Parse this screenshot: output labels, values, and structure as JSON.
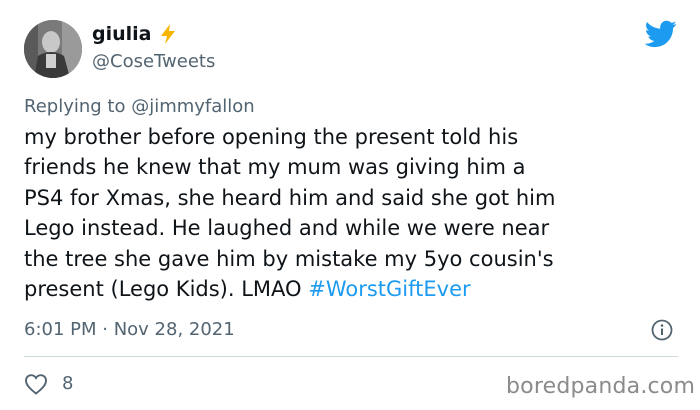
{
  "author": {
    "display_name": "giulia",
    "handle": "@CoseTweets",
    "verified_emoji": "lightning-icon"
  },
  "reply": {
    "prefix": "Replying to ",
    "target": "@jimmyfallon"
  },
  "tweet": {
    "lines": [
      "my brother before opening the present told his",
      "friends he knew that my mum was giving him a",
      "PS4 for Xmas, she heard him and said she got him",
      "Lego instead. He laughed and while we were near",
      "the tree she gave him by mistake my 5yo cousin's",
      "present (Lego Kids). LMAO "
    ],
    "hashtag": "#WorstGiftEver"
  },
  "meta": {
    "timestamp": "6:01 PM · Nov 28, 2021"
  },
  "stats": {
    "likes": "8"
  },
  "watermark": "boredpanda.com",
  "colors": {
    "link": "#1d9bf0",
    "secondary_text": "#536471",
    "primary_text": "#0f1419",
    "lightning": "#f7b500"
  },
  "icons": {
    "brand": "twitter-bird-icon",
    "info": "info-icon",
    "like": "heart-icon"
  }
}
